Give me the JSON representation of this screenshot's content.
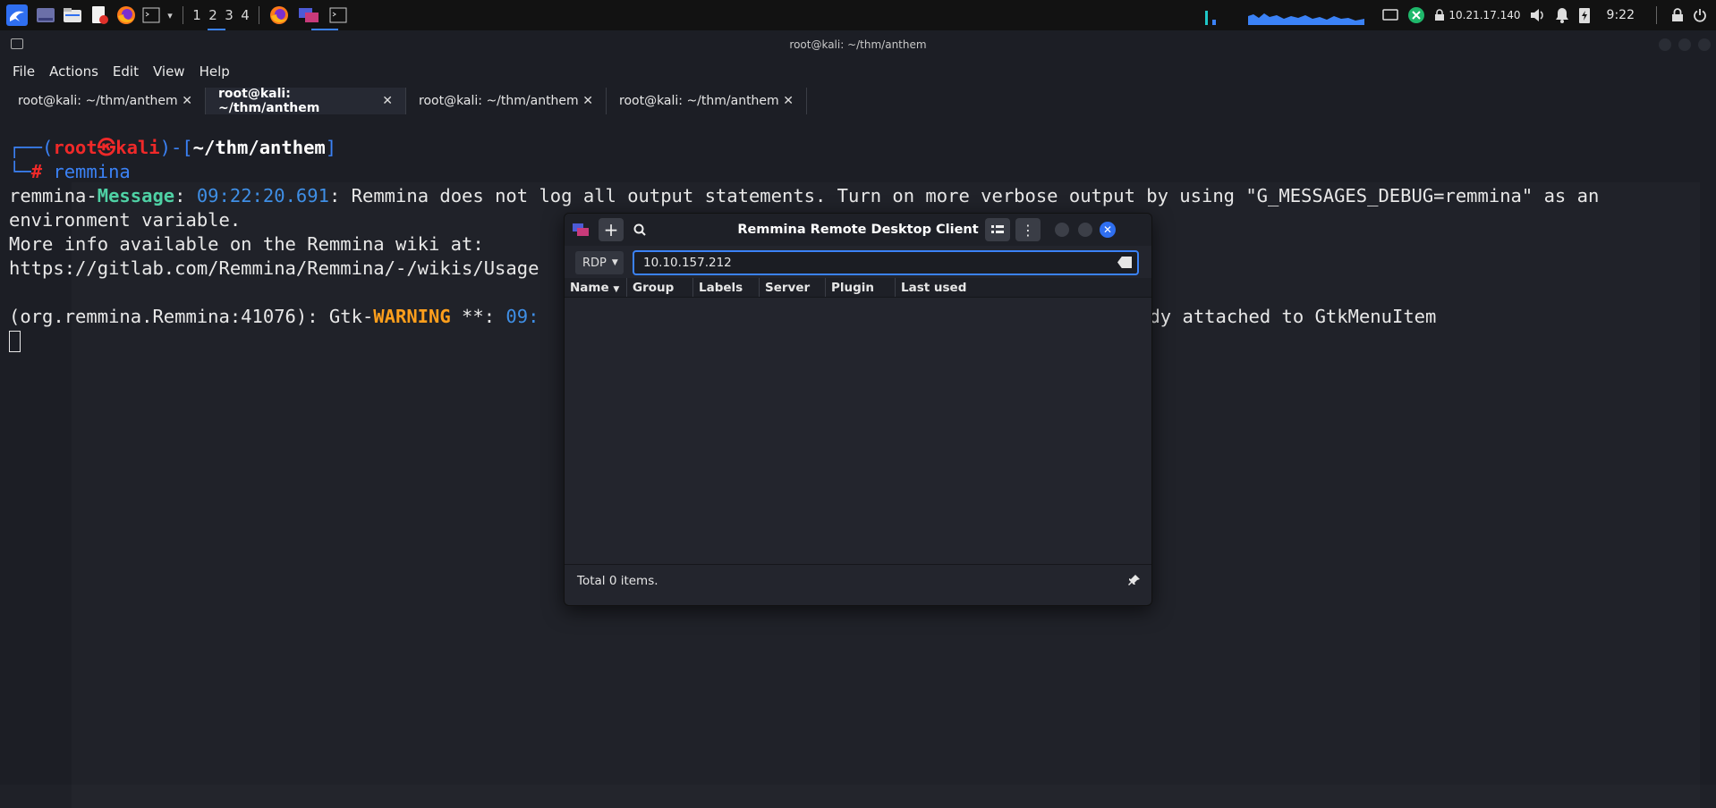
{
  "panel": {
    "workspaces": [
      "1",
      "2",
      "3",
      "4"
    ],
    "ip": "10.21.17.140",
    "clock": "9:22"
  },
  "terminal": {
    "window_title": "root@kali: ~/thm/anthem",
    "menu": [
      "File",
      "Actions",
      "Edit",
      "View",
      "Help"
    ],
    "tabs": [
      {
        "label": "root@kali: ~/thm/anthem",
        "active": false
      },
      {
        "label": "root@kali: ~/thm/anthem",
        "active": true
      },
      {
        "label": "root@kali: ~/thm/anthem",
        "active": false
      },
      {
        "label": "root@kali: ~/thm/anthem",
        "active": false
      }
    ],
    "prompt_user": "root",
    "prompt_host": "kali",
    "prompt_dir": "~/thm/anthem",
    "command": "remmina",
    "msg_prefix": "remmina-",
    "msg_tag": "Message",
    "msg_time": "09:22:20.691",
    "msg_text": ": Remmina does not log all output statements. Turn on more verbose output by using \"G_MESSAGES_DEBUG=remmina\" as an",
    "msg_text2": "environment variable.",
    "wiki_line": "More info available on the Remmina wiki at:",
    "wiki_url": "https://gitlab.com/Remmina/Remmina/-/wikis/Usage",
    "warn_prefix": "(org.remmina.Remmina:41076): Gtk-",
    "warn_tag": "WARNING",
    "warn_mid": " **: ",
    "warn_time": "09:",
    "warn_tail": "dy attached to GtkMenuItem"
  },
  "remmina": {
    "title": "Remmina Remote Desktop Client",
    "protocol": "RDP",
    "address": "10.10.157.212",
    "columns": [
      "Name",
      "Group",
      "Labels",
      "Server",
      "Plugin",
      "Last used"
    ],
    "footer": "Total 0 items."
  },
  "colors": {
    "accent": "#3b82f6",
    "kali_red": "#ef2929",
    "message_green": "#4fd1a5",
    "warning_orange": "#ff9f1c"
  }
}
